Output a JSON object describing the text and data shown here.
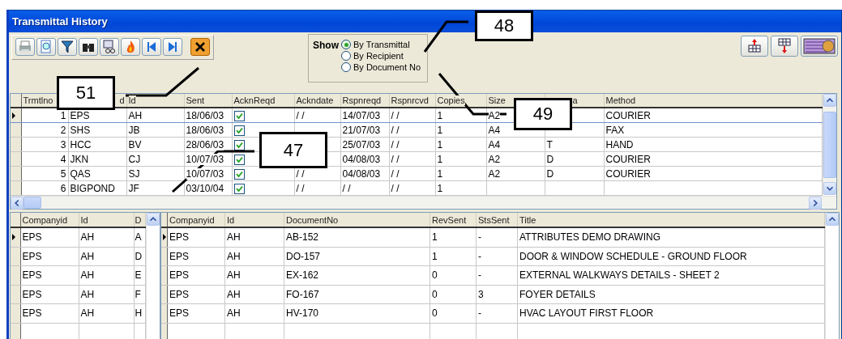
{
  "window": {
    "title": "Transmittal History"
  },
  "toolbar": {
    "buttons": [
      {
        "kind": "print"
      },
      {
        "kind": "preview"
      },
      {
        "kind": "filter"
      },
      {
        "kind": "find"
      },
      {
        "kind": "view"
      },
      {
        "kind": "fire"
      },
      {
        "kind": "first"
      },
      {
        "kind": "last"
      },
      {
        "kind": "close"
      }
    ]
  },
  "show_filter": {
    "label": "Show",
    "options": [
      {
        "label": "By Transmittal",
        "selected": true
      },
      {
        "label": "By Recipient",
        "selected": false
      },
      {
        "label": "By Document No",
        "selected": false
      }
    ]
  },
  "right_buttons": [
    {
      "kind": "export"
    },
    {
      "kind": "import"
    },
    {
      "kind": "report"
    }
  ],
  "transmittals": {
    "columns": [
      {
        "label": "Trmtlno",
        "kind": "num"
      },
      {
        "label": "d",
        "kind": "text"
      },
      {
        "label": "Id",
        "kind": "text"
      },
      {
        "label": "Sent",
        "kind": "text"
      },
      {
        "label": "AcknReqd",
        "kind": "check"
      },
      {
        "label": "Ackndate",
        "kind": "text"
      },
      {
        "label": "Rspnreqd",
        "kind": "text"
      },
      {
        "label": "Rspnrcvd",
        "kind": "text"
      },
      {
        "label": "Copies",
        "kind": "text"
      },
      {
        "label": "Size",
        "kind": "text"
      },
      {
        "label": "a",
        "kind": "text"
      },
      {
        "label": "Method",
        "kind": "text"
      }
    ],
    "rows": [
      {
        "selected": true,
        "acknreqd": true,
        "cells": [
          "1",
          "EPS",
          "AH",
          "18/06/03",
          null,
          "/ /",
          "14/07/03",
          "/ /",
          "1",
          "A2",
          null,
          "COURIER"
        ]
      },
      {
        "selected": false,
        "acknreqd": true,
        "cells": [
          "2",
          "SHS",
          "JB",
          "18/06/03",
          null,
          null,
          "21/07/03",
          "/ /",
          "1",
          "A4",
          null,
          "FAX"
        ]
      },
      {
        "selected": false,
        "acknreqd": true,
        "cells": [
          "3",
          "HCC",
          "BV",
          "28/06/03",
          null,
          null,
          "25/07/03",
          "/ /",
          "1",
          "A4",
          "T",
          "HAND"
        ]
      },
      {
        "selected": false,
        "acknreqd": true,
        "cells": [
          "4",
          "JKN",
          "CJ",
          "10/07/03",
          null,
          null,
          "04/08/03",
          "/ /",
          "1",
          "A2",
          "D",
          "COURIER"
        ]
      },
      {
        "selected": false,
        "acknreqd": true,
        "cells": [
          "5",
          "QAS",
          "SJ",
          "10/07/03",
          null,
          "/ /",
          "04/08/03",
          "/ /",
          "1",
          "A2",
          "D",
          "COURIER"
        ]
      },
      {
        "selected": false,
        "acknreqd": true,
        "cells": [
          "6",
          "BIGPOND",
          "JF",
          "03/10/04",
          null,
          "/ /",
          "/ /",
          "/ /",
          "1",
          null,
          null,
          null
        ]
      }
    ]
  },
  "recipients": {
    "columns": [
      "Companyid",
      "Id",
      "D"
    ],
    "rows": [
      {
        "selected": true,
        "cells": [
          "EPS",
          "AH",
          "A"
        ]
      },
      {
        "selected": false,
        "cells": [
          "EPS",
          "AH",
          "D"
        ]
      },
      {
        "selected": false,
        "cells": [
          "EPS",
          "AH",
          "E"
        ]
      },
      {
        "selected": false,
        "cells": [
          "EPS",
          "AH",
          "F"
        ]
      },
      {
        "selected": false,
        "cells": [
          "EPS",
          "AH",
          "H"
        ]
      }
    ]
  },
  "documents": {
    "columns": [
      "Companyid",
      "Id",
      "DocumentNo",
      "RevSent",
      "StsSent",
      "Title"
    ],
    "rows": [
      {
        "selected": true,
        "cells": [
          "EPS",
          "AH",
          "AB-152",
          "1",
          "-",
          "ATTRIBUTES DEMO DRAWING"
        ]
      },
      {
        "selected": false,
        "cells": [
          "EPS",
          "AH",
          "DO-157",
          "1",
          "-",
          "DOOR & WINDOW SCHEDULE - GROUND FLOOR"
        ]
      },
      {
        "selected": false,
        "cells": [
          "EPS",
          "AH",
          "EX-162",
          "0",
          "-",
          "EXTERNAL WALKWAYS DETAILS - SHEET 2"
        ]
      },
      {
        "selected": false,
        "cells": [
          "EPS",
          "AH",
          "FO-167",
          "0",
          "3",
          "FOYER DETAILS"
        ]
      },
      {
        "selected": false,
        "cells": [
          "EPS",
          "AH",
          "HV-170",
          "0",
          "-",
          "HVAC LAYOUT FIRST FLOOR"
        ]
      }
    ]
  },
  "callouts": [
    {
      "label": "48"
    },
    {
      "label": "51"
    },
    {
      "label": "49"
    },
    {
      "label": "47"
    }
  ]
}
